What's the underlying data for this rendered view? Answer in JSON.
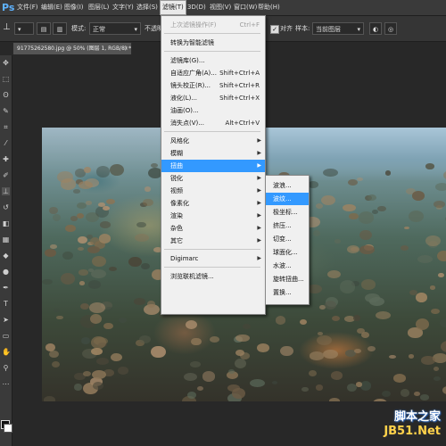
{
  "app": {
    "logo": "Ps"
  },
  "menubar": {
    "items": [
      {
        "label": "文件(F)"
      },
      {
        "label": "编辑(E)"
      },
      {
        "label": "图像(I)"
      },
      {
        "label": "图层(L)"
      },
      {
        "label": "文字(Y)"
      },
      {
        "label": "选择(S)"
      },
      {
        "label": "滤镜(T)"
      },
      {
        "label": "3D(D)"
      },
      {
        "label": "视图(V)"
      },
      {
        "label": "窗口(W)"
      },
      {
        "label": "帮助(H)"
      }
    ]
  },
  "options": {
    "mode_label": "模式:",
    "mode_value": "正常",
    "opacity_label": "不透明",
    "contiguous_label": "对齐",
    "sample_label": "样本:",
    "sample_value": "当前图层"
  },
  "document": {
    "tab_title": "91775262580.jpg @ 50% (图层 1, RGB/8) *",
    "close": "×"
  },
  "filter_menu": {
    "items": [
      {
        "label": "上次滤镜操作(F)",
        "shortcut": "Ctrl+F",
        "disabled": true
      },
      {
        "sep": true
      },
      {
        "label": "转换为智能滤镜"
      },
      {
        "sep": true
      },
      {
        "label": "滤镜库(G)..."
      },
      {
        "label": "自适应广角(A)...",
        "shortcut": "Shift+Ctrl+A"
      },
      {
        "label": "镜头校正(R)...",
        "shortcut": "Shift+Ctrl+R"
      },
      {
        "label": "液化(L)...",
        "shortcut": "Shift+Ctrl+X"
      },
      {
        "label": "油画(O)..."
      },
      {
        "label": "消失点(V)...",
        "shortcut": "Alt+Ctrl+V"
      },
      {
        "sep": true
      },
      {
        "label": "风格化",
        "submenu": true
      },
      {
        "label": "模糊",
        "submenu": true
      },
      {
        "label": "扭曲",
        "submenu": true,
        "highlighted": true
      },
      {
        "label": "锐化",
        "submenu": true
      },
      {
        "label": "视频",
        "submenu": true
      },
      {
        "label": "像素化",
        "submenu": true
      },
      {
        "label": "渲染",
        "submenu": true
      },
      {
        "label": "杂色",
        "submenu": true
      },
      {
        "label": "其它",
        "submenu": true
      },
      {
        "sep": true
      },
      {
        "label": "Digimarc",
        "submenu": true
      },
      {
        "sep": true
      },
      {
        "label": "浏览联机滤镜..."
      }
    ]
  },
  "distort_submenu": {
    "items": [
      {
        "label": "波浪..."
      },
      {
        "label": "波纹...",
        "highlighted": true
      },
      {
        "label": "极坐标..."
      },
      {
        "label": "挤压..."
      },
      {
        "label": "切变..."
      },
      {
        "label": "球面化..."
      },
      {
        "label": "水波..."
      },
      {
        "label": "旋转扭曲..."
      },
      {
        "label": "置换..."
      }
    ]
  },
  "watermark": {
    "line1": "脚本之家",
    "line2": "JB51.Net"
  },
  "colors": {
    "highlight": "#3399ff",
    "menu_bg": "#f0f0f0",
    "ui_bg": "#282828"
  }
}
